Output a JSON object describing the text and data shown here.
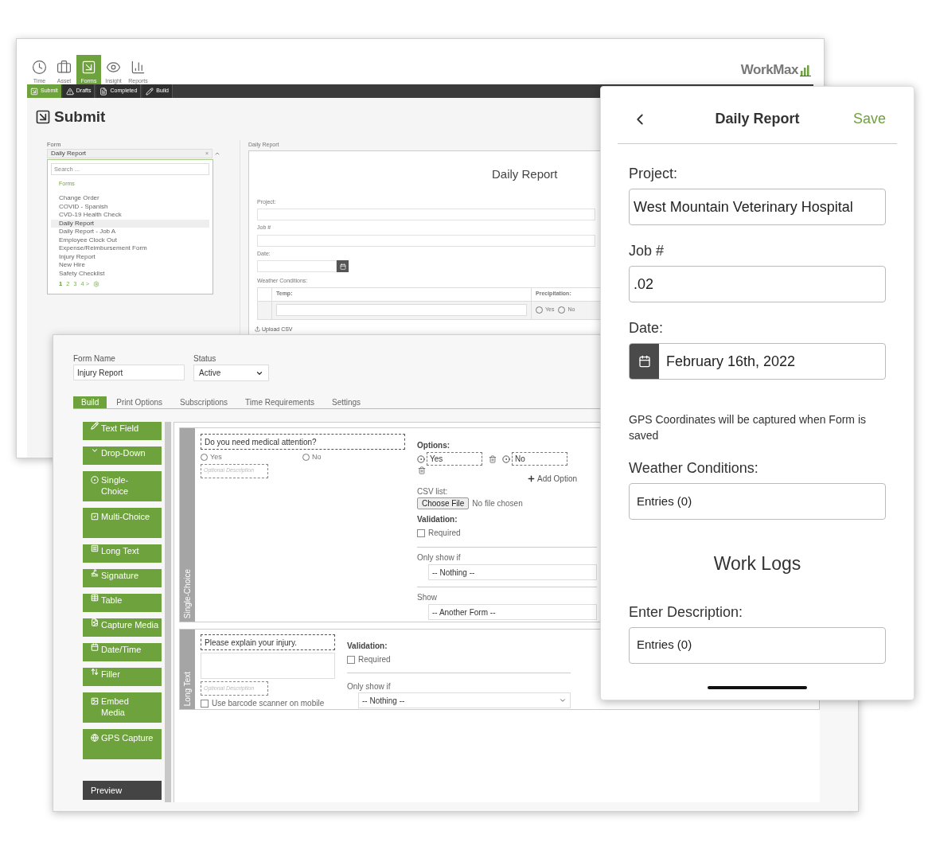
{
  "admin_window": {
    "toolbar": [
      {
        "label": "Time",
        "selected": false
      },
      {
        "label": "Asset",
        "selected": false
      },
      {
        "label": "Forms",
        "selected": true
      },
      {
        "label": "Insight",
        "selected": false
      },
      {
        "label": "Reports",
        "selected": false
      }
    ],
    "logo": "WorkMax",
    "nav_tabs": [
      {
        "label": "Submit",
        "selected": true
      },
      {
        "label": "Drafts",
        "selected": false
      },
      {
        "label": "Completed",
        "selected": false
      },
      {
        "label": "Build",
        "selected": false
      }
    ],
    "page_title": "Submit",
    "form_picker": {
      "label": "Form",
      "value": "Daily Report",
      "clear": "×",
      "search_placeholder": "Search ...",
      "group": "Forms",
      "items": [
        {
          "label": "Change Order",
          "selected": false
        },
        {
          "label": "COVID - Spanish",
          "selected": false
        },
        {
          "label": "CVD-19 Health Check",
          "selected": false
        },
        {
          "label": "Daily Report",
          "selected": true
        },
        {
          "label": "Daily Report - Job A",
          "selected": false
        },
        {
          "label": "Employee Clock Out",
          "selected": false
        },
        {
          "label": "Expense/Reimbursement Form",
          "selected": false
        },
        {
          "label": "Injury Report",
          "selected": false
        },
        {
          "label": "New Hire",
          "selected": false
        },
        {
          "label": "Safety Checklist",
          "selected": false
        }
      ],
      "pages": [
        {
          "label": "1",
          "selected": true
        },
        {
          "label": "2",
          "selected": false
        },
        {
          "label": "3",
          "selected": false
        },
        {
          "label": "4 >",
          "selected": false
        }
      ]
    },
    "preview": {
      "label": "Daily Report",
      "title": "Daily Report",
      "fields": [
        "Project:",
        "Job #"
      ],
      "date_label": "Date:",
      "table": {
        "label": "Weather Conditions:",
        "columns": [
          "Temp:",
          "Precipitation:"
        ],
        "options": [
          {
            "label": "Yes",
            "selected": false
          },
          {
            "label": "No",
            "selected": false
          }
        ]
      },
      "upload": "Upload CSV"
    }
  },
  "builder_window": {
    "form_name": {
      "label": "Form Name",
      "value": "Injury Report"
    },
    "status": {
      "label": "Status",
      "value": "Active"
    },
    "tabs": [
      {
        "label": "Build",
        "selected": true
      },
      {
        "label": "Print Options",
        "selected": false
      },
      {
        "label": "Subscriptions",
        "selected": false
      },
      {
        "label": "Time Requirements",
        "selected": false
      },
      {
        "label": "Settings",
        "selected": false
      }
    ],
    "palette": [
      "Text Field",
      "Drop-Down",
      "Single-Choice",
      "Multi-Choice",
      "Long Text",
      "Signature",
      "Table",
      "Capture Media",
      "Date/Time",
      "Filler",
      "Embed Media",
      "GPS Capture"
    ],
    "preview_button": "Preview",
    "cards": [
      {
        "kind": "single_choice",
        "type_label": "Single-Choice",
        "question": "Do you need medical attention?",
        "choices": [
          {
            "label": "Yes",
            "selected": false
          },
          {
            "label": "No",
            "selected": false
          }
        ],
        "description_placeholder": "Optional Description",
        "options_label": "Options:",
        "options": [
          "Yes",
          "No"
        ],
        "add_option": "Add Option",
        "csv_label": "CSV list:",
        "file_button": "Choose File",
        "file_status": "No file chosen",
        "validation_label": "Validation:",
        "required": {
          "label": "Required",
          "checked": false
        },
        "show_if_label": "Only show if",
        "show_if_value": "-- Nothing --",
        "show_label": "Show",
        "show_value": "-- Another Form --"
      },
      {
        "kind": "long_text",
        "type_label": "Long Text",
        "question": "Please explain your injury.",
        "description_placeholder": "Optional Description",
        "barcode": {
          "label": "Use barcode scanner on mobile",
          "checked": false
        },
        "validation_label": "Validation:",
        "required": {
          "label": "Required",
          "checked": false
        },
        "show_if_label": "Only show if",
        "show_if_value": "-- Nothing --"
      }
    ]
  },
  "mobile": {
    "title": "Daily Report",
    "save": "Save",
    "fields": [
      {
        "kind": "text",
        "label": "Project:",
        "value": "West Mountain Veterinary Hospital"
      },
      {
        "kind": "text",
        "label": "Job #",
        "value": ".02"
      },
      {
        "kind": "date",
        "label": "Date:",
        "value": "February 16th, 2022"
      },
      {
        "kind": "note",
        "text": "GPS Coordinates will be captured when Form is saved"
      },
      {
        "kind": "entries",
        "label": "Weather Conditions:",
        "value": "Entries (0)"
      },
      {
        "kind": "section",
        "text": "Work Logs"
      },
      {
        "kind": "entries",
        "label": "Enter Description:",
        "value": "Entries (0)"
      }
    ]
  }
}
